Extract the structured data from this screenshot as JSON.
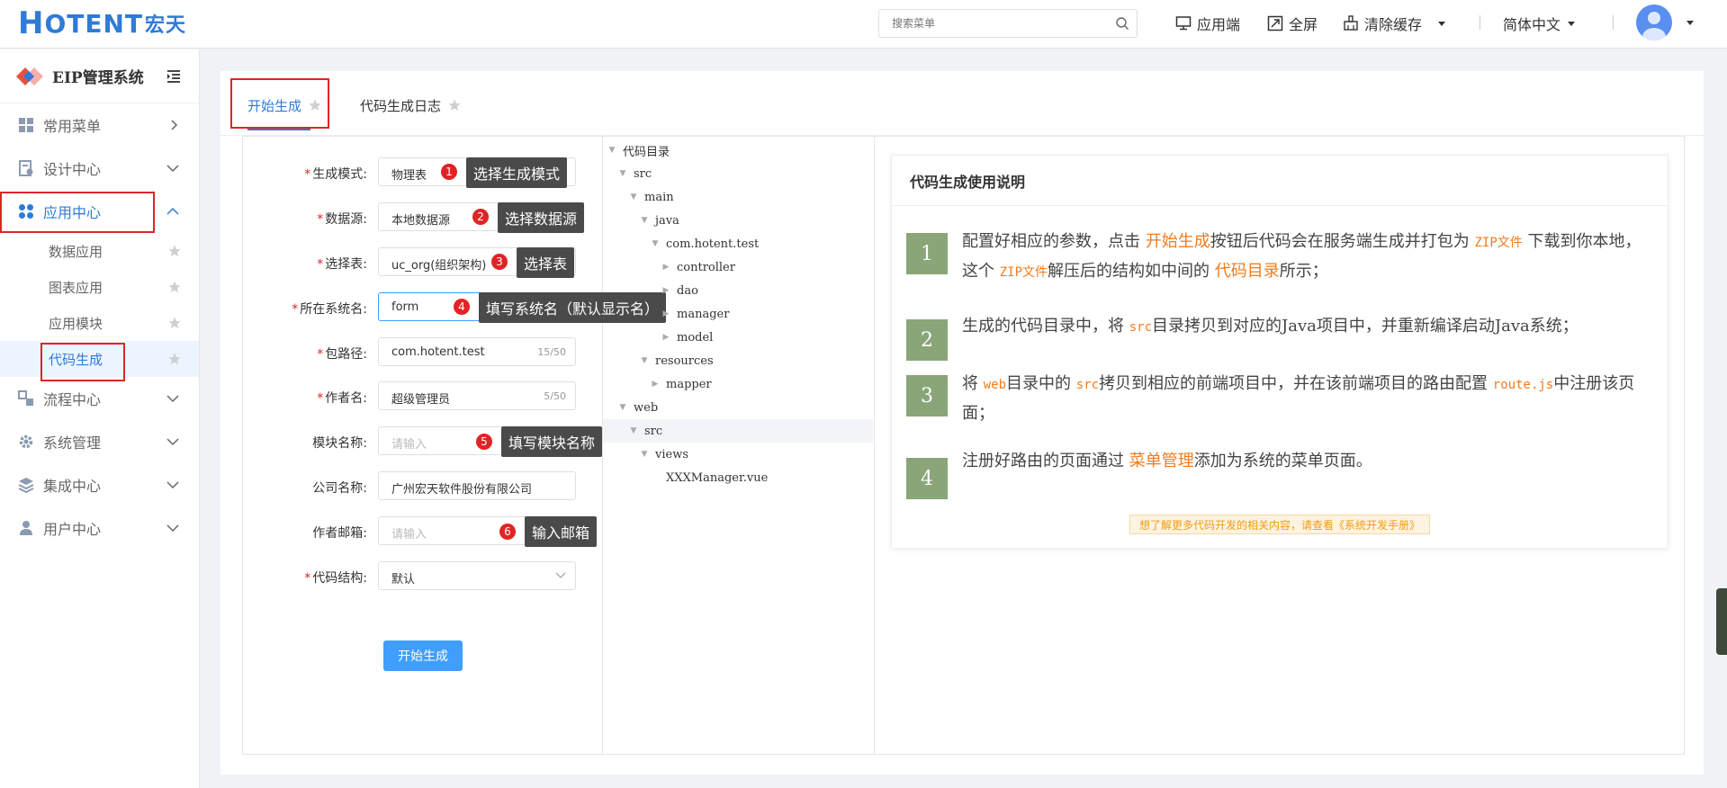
{
  "topbar": {
    "logo_h": "H",
    "logo_text": "OTENT",
    "logo_cn": "宏天",
    "search_placeholder": "搜索菜单",
    "app_label": "应用端",
    "fullscreen_label": "全屏",
    "clear_cache_label": "清除缓存",
    "language_label": "简体中文"
  },
  "sidebar": {
    "title": "EIP管理系统",
    "menus": [
      {
        "label": "常用菜单"
      },
      {
        "label": "设计中心"
      },
      {
        "label": "应用中心"
      },
      {
        "label": "流程中心"
      },
      {
        "label": "系统管理"
      },
      {
        "label": "集成中心"
      },
      {
        "label": "用户中心"
      }
    ],
    "submenu": [
      {
        "label": "数据应用"
      },
      {
        "label": "图表应用"
      },
      {
        "label": "应用模块"
      },
      {
        "label": "代码生成"
      }
    ]
  },
  "tabs": [
    {
      "label": "开始生成"
    },
    {
      "label": "代码生成日志"
    }
  ],
  "form": {
    "fields": [
      {
        "label": "生成模式:",
        "value": "物理表",
        "required": true
      },
      {
        "label": "数据源:",
        "value": "本地数据源",
        "required": true
      },
      {
        "label": "选择表:",
        "value": "uc_org(组织架构)",
        "required": true
      },
      {
        "label": "所在系统名:",
        "value": "form",
        "required": true
      },
      {
        "label": "包路径:",
        "value": "com.hotent.test",
        "count": "15/50",
        "required": true
      },
      {
        "label": "作者名:",
        "value": "超级管理员",
        "count": "5/50",
        "required": true
      },
      {
        "label": "模块名称:",
        "placeholder": "请输入",
        "required": false
      },
      {
        "label": "公司名称:",
        "value": "广州宏天软件股份有限公司",
        "required": false
      },
      {
        "label": "作者邮箱:",
        "placeholder": "请输入",
        "required": false
      },
      {
        "label": "代码结构:",
        "value": "默认",
        "required": true
      }
    ],
    "tips": [
      {
        "num": "1",
        "text": "选择生成模式"
      },
      {
        "num": "2",
        "text": "选择数据源"
      },
      {
        "num": "3",
        "text": "选择表"
      },
      {
        "num": "4",
        "text": "填写系统名（默认显示名）"
      },
      {
        "num": "5",
        "text": "填写模块名称"
      },
      {
        "num": "6",
        "text": "输入邮箱"
      }
    ],
    "submit_label": "开始生成"
  },
  "tree": {
    "nodes": [
      {
        "label": "代码目录"
      },
      {
        "label": "src"
      },
      {
        "label": "main"
      },
      {
        "label": "java"
      },
      {
        "label": "com.hotent.test"
      },
      {
        "label": "controller"
      },
      {
        "label": "dao"
      },
      {
        "label": "manager"
      },
      {
        "label": "model"
      },
      {
        "label": "resources"
      },
      {
        "label": "mapper"
      },
      {
        "label": "web"
      },
      {
        "label": "src"
      },
      {
        "label": "views"
      },
      {
        "label": "XXXManager.vue"
      }
    ]
  },
  "doc": {
    "title": "代码生成使用说明",
    "steps": [
      {
        "num": "1",
        "p1": "配置好相应的参数，点击 ",
        "hl1": "开始生成",
        "p2": "按钮后代码会在服务端生成并打包为 ",
        "code1": "ZIP文件",
        "p3": " 下载到你本地，这个 ",
        "code2": "ZIP文件",
        "p4": "解压后的结构如中间的 ",
        "hl2": "代码目录",
        "p5": "所示；"
      },
      {
        "num": "2",
        "p1": "生成的代码目录中，将 ",
        "code1": "src",
        "p2": "目录拷贝到对应的Java项目中，并重新编译启动Java系统；"
      },
      {
        "num": "3",
        "p1": "将 ",
        "code1": "web",
        "p2": "目录中的 ",
        "code2": "src",
        "p3": "拷贝到相应的前端项目中，并在该前端项目的路由配置 ",
        "code3": "route.js",
        "p4": "中注册该页面；"
      },
      {
        "num": "4",
        "p1": "注册好路由的页面通过 ",
        "hl1": "菜单管理",
        "p2": "添加为系统的菜单页面。"
      }
    ],
    "note": "想了解更多代码开发的相关内容，请查看《系统开发手册》"
  }
}
